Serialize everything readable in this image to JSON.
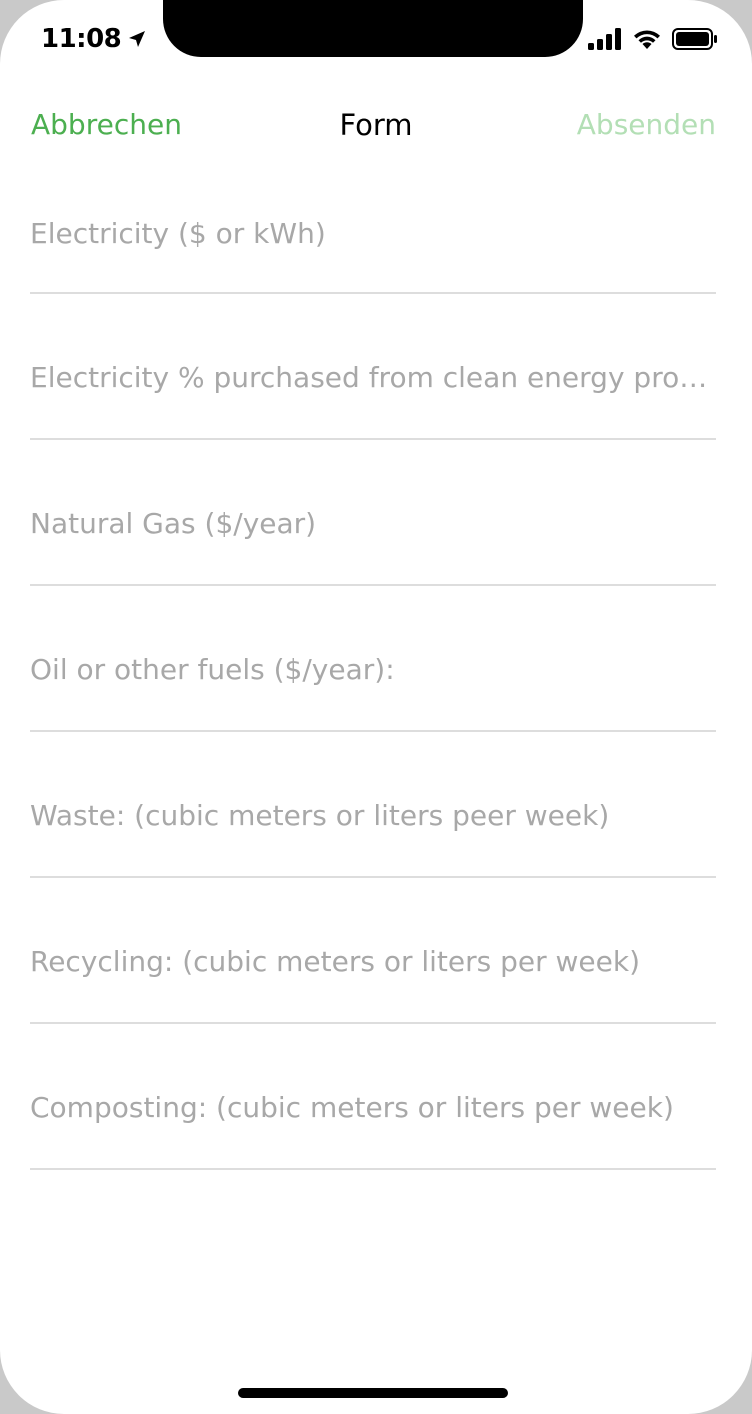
{
  "status_bar": {
    "time": "11:08",
    "icons": [
      "location-arrow-icon",
      "signal-icon",
      "wifi-icon",
      "battery-icon"
    ]
  },
  "nav": {
    "cancel_label": "Abbrechen",
    "title": "Form",
    "submit_label": "Absenden",
    "colors": {
      "accent": "#4caf50",
      "disabled_accent": "#b3dfb5"
    }
  },
  "form": {
    "fields": [
      {
        "placeholder": "Electricity ($ or kWh)",
        "value": ""
      },
      {
        "placeholder": "Electricity % purchased from clean energy pro…",
        "value": ""
      },
      {
        "placeholder": "Natural Gas ($/year)",
        "value": ""
      },
      {
        "placeholder": "Oil or other fuels ($/year):",
        "value": ""
      },
      {
        "placeholder": "Waste: (cubic meters or liters peer week)",
        "value": ""
      },
      {
        "placeholder": "Recycling: (cubic meters or liters per week)",
        "value": ""
      },
      {
        "placeholder": "Composting: (cubic meters or liters per week)",
        "value": ""
      }
    ]
  }
}
